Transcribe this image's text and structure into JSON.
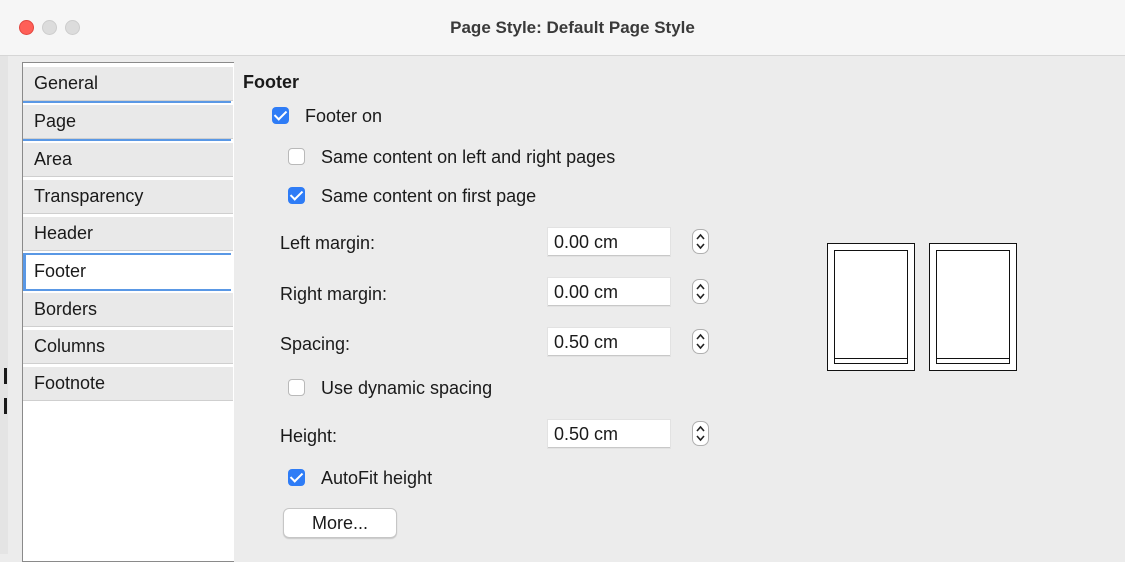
{
  "window": {
    "title": "Page Style: Default Page Style",
    "controls": [
      "close-button",
      "minimize-button",
      "zoom-button"
    ]
  },
  "tabs": [
    {
      "label": "General",
      "active": false
    },
    {
      "label": "Page",
      "active": false
    },
    {
      "label": "Area",
      "active": false
    },
    {
      "label": "Transparency",
      "active": false
    },
    {
      "label": "Header",
      "active": false
    },
    {
      "label": "Footer",
      "active": true
    },
    {
      "label": "Borders",
      "active": false
    },
    {
      "label": "Columns",
      "active": false
    },
    {
      "label": "Footnote",
      "active": false
    }
  ],
  "footer": {
    "section_title": "Footer",
    "footer_on": {
      "label": "Footer on",
      "checked": true
    },
    "same_left_right": {
      "label": "Same content on left and right pages",
      "checked": false
    },
    "same_first_page": {
      "label": "Same content on first page",
      "checked": true
    },
    "left_margin": {
      "label": "Left margin:",
      "value": "0.00 cm"
    },
    "right_margin": {
      "label": "Right margin:",
      "value": "0.00 cm"
    },
    "spacing": {
      "label": "Spacing:",
      "value": "0.50 cm"
    },
    "dynamic_spacing": {
      "label": "Use dynamic spacing",
      "checked": false
    },
    "height": {
      "label": "Height:",
      "value": "0.50 cm"
    },
    "autofit": {
      "label": "AutoFit height",
      "checked": true
    },
    "more_button": "More..."
  },
  "colors": {
    "accent": "#2e7cf6",
    "tab_highlight": "#5a98e5",
    "close": "#ff5f57"
  }
}
